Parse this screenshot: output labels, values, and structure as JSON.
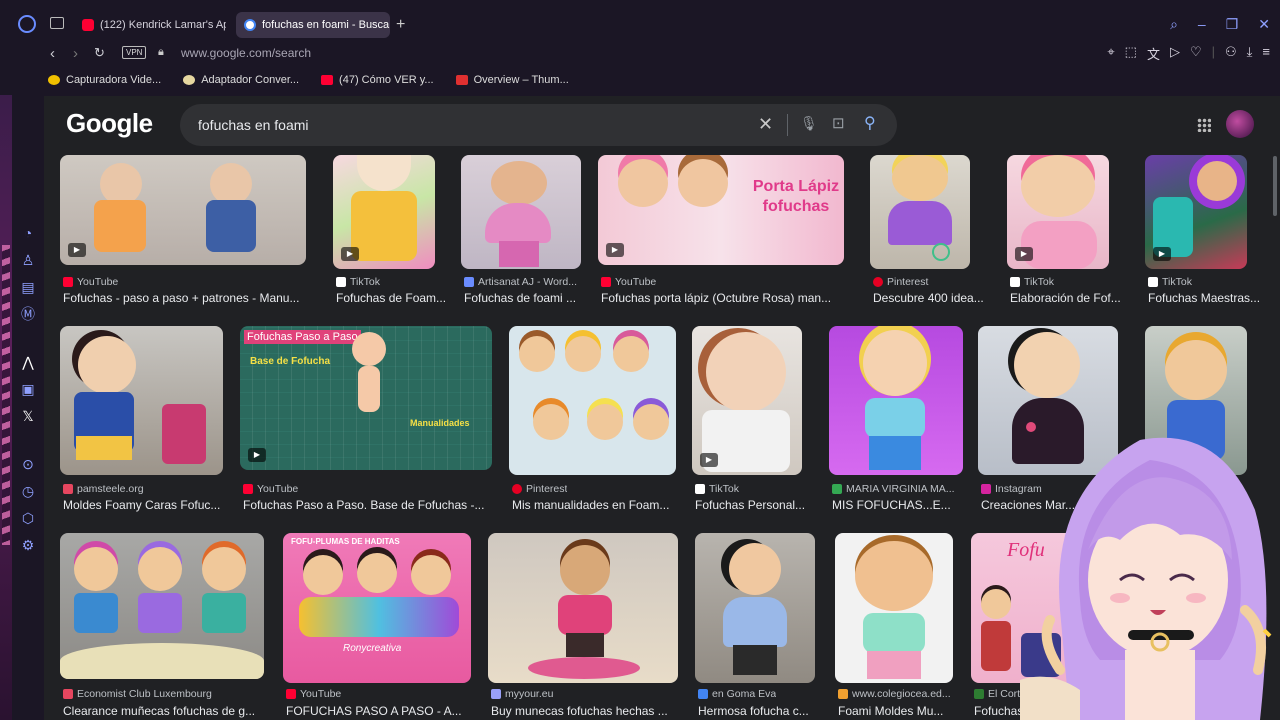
{
  "tabs": [
    {
      "label": "(122) Kendrick Lamar's Ap",
      "favicon_color": "#ff0033"
    },
    {
      "label": "fofuchas en foami - Busca",
      "favicon_color": "#4285f4",
      "active": true
    }
  ],
  "address": {
    "url": "www.google.com/search",
    "vpn_label": "VPN"
  },
  "bookmarks": [
    {
      "label": "Capturadora Vide...",
      "favicon_color": "#f0c000"
    },
    {
      "label": "Adaptador Conver...",
      "favicon_color": "#e6d7a0"
    },
    {
      "label": "(47) Cómo VER y...",
      "favicon_color": "#ff0033"
    },
    {
      "label": "Overview – Thum...",
      "favicon_color": "#e03030"
    }
  ],
  "google": {
    "logo": "Google",
    "query": "fofuchas en foami"
  },
  "results": [
    {
      "source": "YouTube",
      "title": "Fofuchas - paso a paso + patrones - Manu...",
      "icon_color": "#ff0033",
      "video": true
    },
    {
      "source": "TikTok",
      "title": "Fofuchas de Foam...",
      "icon_color": "#ffffff",
      "video": true
    },
    {
      "source": "Artisanat AJ - Word...",
      "title": "Fofuchas de foami ...",
      "icon_color": "#6a8cff",
      "video": false
    },
    {
      "source": "YouTube",
      "title": "Fofuchas porta lápiz (Octubre Rosa) man...",
      "icon_color": "#ff0033",
      "video": true
    },
    {
      "source": "Pinterest",
      "title": "Descubre 400 idea...",
      "icon_color": "#e60023",
      "video": false
    },
    {
      "source": "TikTok",
      "title": "Elaboración de Fof...",
      "icon_color": "#ffffff",
      "video": true
    },
    {
      "source": "TikTok",
      "title": "Fofuchas Maestras...",
      "icon_color": "#ffffff",
      "video": true
    },
    {
      "source": "pamsteele.org",
      "title": "Moldes Foamy Caras Fofuc...",
      "icon_color": "#e6465f",
      "video": false
    },
    {
      "source": "YouTube",
      "title": "Fofuchas Paso a Paso. Base de Fofuchas -...",
      "icon_color": "#ff0033",
      "video": true
    },
    {
      "source": "Pinterest",
      "title": "Mis manualidades en Foam...",
      "icon_color": "#e60023",
      "video": false
    },
    {
      "source": "TikTok",
      "title": "Fofuchas Personal...",
      "icon_color": "#ffffff",
      "video": true
    },
    {
      "source": "MARIA VIRGINIA MA...",
      "title": "MIS FOFUCHAS...E...",
      "icon_color": "#34a853",
      "video": false
    },
    {
      "source": "Instagram",
      "title": "Creaciones Mar...",
      "icon_color": "#d6249f",
      "video": false
    },
    {
      "source": "Economist Club Luxembourg",
      "title": "Clearance muñecas fofuchas de g...",
      "icon_color": "#e6465f",
      "video": false
    },
    {
      "source": "YouTube",
      "title": "FOFUCHAS PASO A PASO - A...",
      "icon_color": "#ff0033",
      "video": false
    },
    {
      "source": "myyour.eu",
      "title": "Buy munecas fofuchas hechas ...",
      "icon_color": "#9aa0f8",
      "video": false
    },
    {
      "source": "en Goma Eva",
      "title": "Hermosa fofucha c...",
      "icon_color": "#4285f4",
      "video": false
    },
    {
      "source": "www.colegiocea.ed...",
      "title": "Foami Moldes Mu...",
      "icon_color": "#f0a030",
      "video": false
    },
    {
      "source": "El Corte Ingl...",
      "title": "Fofuchas. M...",
      "icon_color": "#2e7d32",
      "video": false
    }
  ],
  "thumb_texts": {
    "porta_lapiz": "Porta Lápiz fofuchas",
    "paso_a_paso": "Fofuchas Paso a Paso",
    "base": "Base de Fofucha",
    "manualidades": "Manualidades",
    "plumas": "FOFU-PLUMAS DE HADITAS",
    "rony": "Ronycreativa",
    "fofu": "Fofu"
  }
}
